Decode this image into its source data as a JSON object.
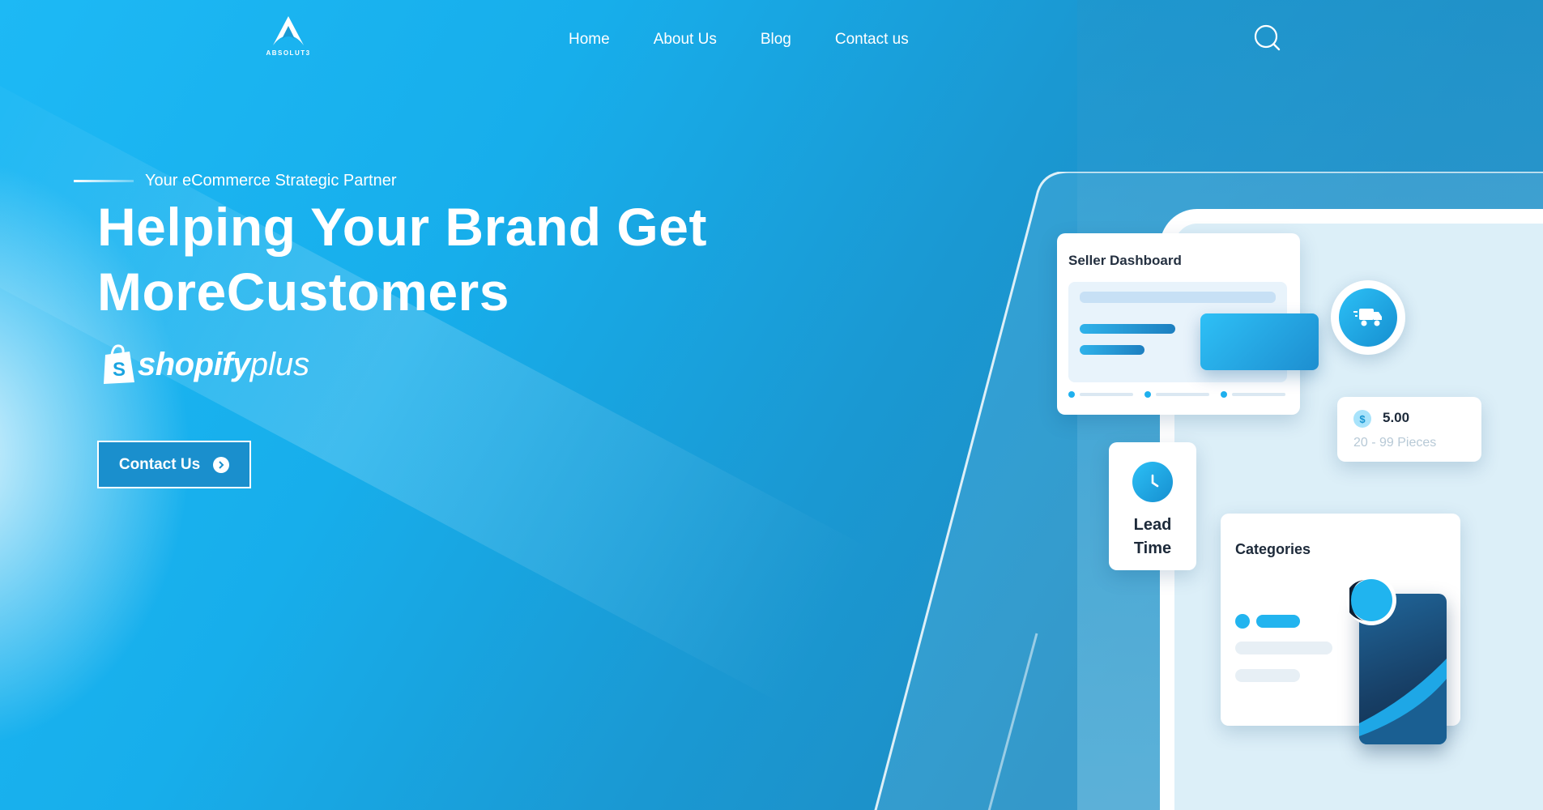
{
  "brand": {
    "logo_text": "ABSOLUT3"
  },
  "nav": {
    "items": [
      {
        "label": "Home"
      },
      {
        "label": "About Us"
      },
      {
        "label": "Blog"
      },
      {
        "label": "Contact us"
      }
    ]
  },
  "search": {
    "icon": "search-icon"
  },
  "hero": {
    "tagline": "Your eCommerce Strategic Partner",
    "headline_line1": "Helping Your Brand Get",
    "headline_line2_regular": "More",
    "headline_line2_bold": "Customers",
    "partner_logo": {
      "word": "shopify",
      "suffix": "plus"
    },
    "cta_label": "Contact Us"
  },
  "mockup": {
    "seller_dashboard_title": "Seller Dashboard",
    "price_value": "5.00",
    "price_currency_symbol": "$",
    "price_range": "20 - 99 Pieces",
    "lead_time_line1": "Lead",
    "lead_time_line2": "Time",
    "categories_title": "Categories"
  },
  "colors": {
    "primary": "#1db9f5",
    "cta_bg": "#1a8fcd",
    "dark_text": "#1d2a3a"
  }
}
